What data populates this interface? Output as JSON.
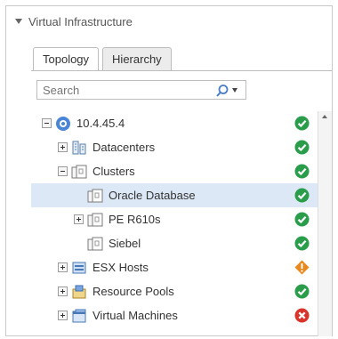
{
  "panel": {
    "title": "Virtual Infrastructure"
  },
  "tabs": [
    {
      "label": "Topology",
      "active": true
    },
    {
      "label": "Hierarchy",
      "active": false
    }
  ],
  "search": {
    "placeholder": "Search"
  },
  "tree": [
    {
      "label": "10.4.45.4",
      "icon": "vcenter-icon",
      "toggle": "collapse",
      "status": "ok"
    },
    {
      "label": "Datacenters",
      "icon": "datacenter-icon",
      "toggle": "expand",
      "status": "ok"
    },
    {
      "label": "Clusters",
      "icon": "cluster-icon",
      "toggle": "collapse",
      "status": "ok"
    },
    {
      "label": "Oracle Database",
      "icon": "cluster-icon",
      "toggle": "none",
      "status": "ok",
      "selected": true
    },
    {
      "label": "PE R610s",
      "icon": "cluster-icon",
      "toggle": "expand",
      "status": "ok"
    },
    {
      "label": "Siebel",
      "icon": "cluster-icon",
      "toggle": "none",
      "status": "ok"
    },
    {
      "label": "ESX Hosts",
      "icon": "esx-host-icon",
      "toggle": "expand",
      "status": "warning"
    },
    {
      "label": "Resource Pools",
      "icon": "resource-pool-icon",
      "toggle": "expand",
      "status": "ok"
    },
    {
      "label": "Virtual Machines",
      "icon": "virtual-machine-icon",
      "toggle": "expand",
      "status": "critical"
    }
  ],
  "colors": {
    "ok": "#2a9d4b",
    "warning": "#e8891f",
    "critical": "#d9342b",
    "selected": "#dde8f6"
  }
}
